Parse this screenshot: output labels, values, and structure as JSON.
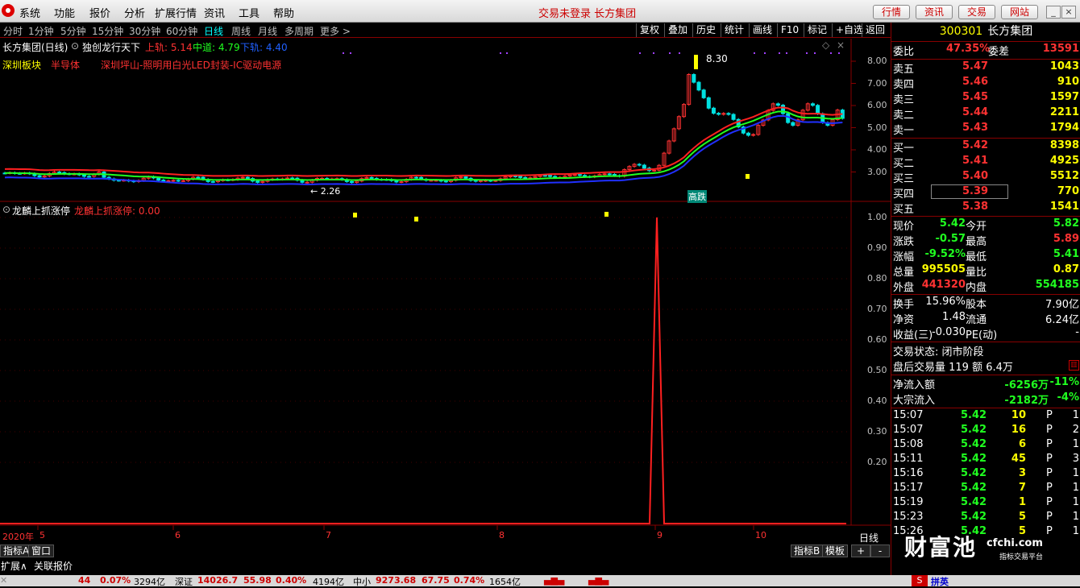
{
  "menu": {
    "items": [
      "系统",
      "功能",
      "报价",
      "分析",
      "扩展行情",
      "资讯",
      "工具",
      "帮助"
    ],
    "title": "交易未登录 长方集团",
    "right_buttons": [
      "行情",
      "资讯",
      "交易",
      "网站"
    ]
  },
  "tabs": {
    "periods": [
      "分时",
      "1分钟",
      "5分钟",
      "15分钟",
      "30分钟",
      "60分钟",
      "日线",
      "周线",
      "月线",
      "多周期",
      "更多 >"
    ],
    "selected": "日线",
    "tools": [
      "复权",
      "叠加",
      "历史",
      "统计",
      "画线",
      "F10",
      "标记",
      "+自选",
      "返回"
    ]
  },
  "chart": {
    "title": "长方集团(日线)",
    "indicator_name": "独创龙行天下",
    "upper": "上轨: 5.14",
    "middle": "中道: 4.79",
    "lower": "下轨: 4.40",
    "tags": [
      "深圳板块",
      "半导体",
      "深圳坪山-照明用白光LED封装-IC驱动电源"
    ],
    "high_mark": "8.30",
    "low_mark": "2.26",
    "event_label": "高跌",
    "price_axis": [
      "8.00",
      "7.00",
      "6.00",
      "5.00",
      "4.00",
      "3.00"
    ],
    "sub_title": "龙麟上抓涨停",
    "sub_value": "龙麟上抓涨停: 0.00",
    "sub_axis": [
      "1.00",
      "0.90",
      "0.80",
      "0.70",
      "0.60",
      "0.50",
      "0.40",
      "0.30",
      "0.20"
    ],
    "date_axis": [
      "2020年",
      "5",
      "6",
      "7",
      "8",
      "9",
      "10"
    ],
    "period_label": "日线"
  },
  "chart_data": {
    "type": "line",
    "title": "龙麟上抓涨停",
    "x": [
      "2020-05",
      "2020-06",
      "2020-07",
      "2020-08",
      "2020-09",
      "2020-10"
    ],
    "ylim": [
      0,
      1
    ],
    "series": [
      {
        "name": "龙麟上抓涨停",
        "values": [
          0,
          0,
          0,
          0,
          1,
          0
        ]
      }
    ]
  },
  "bottom_tabs": {
    "a": "指标A",
    "b": "窗口",
    "c": "扩展∧",
    "d": "关联报价",
    "e": "指标B",
    "f": "模板",
    "g": "+",
    "h": "-"
  },
  "quote": {
    "code": "300301",
    "name": "长方集团",
    "wei_bi": {
      "label": "委比",
      "value": "47.35%",
      "label2": "委差",
      "value2": "13591"
    },
    "sell": [
      [
        "卖五",
        "5.47",
        "1043"
      ],
      [
        "卖四",
        "5.46",
        "910"
      ],
      [
        "卖三",
        "5.45",
        "1597"
      ],
      [
        "卖二",
        "5.44",
        "2211"
      ],
      [
        "卖一",
        "5.43",
        "1794"
      ]
    ],
    "buy": [
      [
        "买一",
        "5.42",
        "8398"
      ],
      [
        "买二",
        "5.41",
        "4925"
      ],
      [
        "买三",
        "5.40",
        "5512"
      ],
      [
        "买四",
        "5.39",
        "770"
      ],
      [
        "买五",
        "5.38",
        "1541"
      ]
    ],
    "stats": [
      [
        "现价",
        "5.42",
        "今开",
        "5.82"
      ],
      [
        "涨跌",
        "-0.57",
        "最高",
        "5.89"
      ],
      [
        "涨幅",
        "-9.52%",
        "最低",
        "5.41"
      ],
      [
        "总量",
        "995505",
        "量比",
        "0.87"
      ],
      [
        "外盘",
        "441320",
        "内盘",
        "554185"
      ]
    ],
    "fund": [
      [
        "换手",
        "15.96%",
        "股本",
        "7.90亿"
      ],
      [
        "净资",
        "1.48",
        "流通",
        "6.24亿"
      ],
      [
        "收益(三)",
        "-0.030",
        "PE(动)",
        "-"
      ]
    ],
    "status": "交易状态: 闭市阶段",
    "after": "盘后交易量 119 额 6.4万",
    "flow": [
      [
        "净流入额",
        "-6256万",
        "-11%"
      ],
      [
        "大宗流入",
        "-2182万",
        "-4%"
      ]
    ],
    "ticks": [
      [
        "15:07",
        "5.42",
        "10",
        "P",
        "1"
      ],
      [
        "15:07",
        "5.42",
        "16",
        "P",
        "2"
      ],
      [
        "15:08",
        "5.42",
        "6",
        "P",
        "1"
      ],
      [
        "15:11",
        "5.42",
        "45",
        "P",
        "3"
      ],
      [
        "15:16",
        "5.42",
        "3",
        "P",
        "1"
      ],
      [
        "15:17",
        "5.42",
        "7",
        "P",
        "1"
      ],
      [
        "15:19",
        "5.42",
        "1",
        "P",
        "1"
      ],
      [
        "15:23",
        "5.42",
        "5",
        "P",
        "1"
      ],
      [
        "15:26",
        "5.42",
        "5",
        "P",
        "1"
      ]
    ]
  },
  "watermark": {
    "main": "财富池",
    "url": "cfchi.com",
    "sub": "指标交易平台"
  },
  "status_bar": {
    "s1": "44",
    "s2": "0.07%",
    "s3": "3294亿",
    "s4": "深证",
    "s5": "14026.7",
    "s6": "55.98",
    "s7": "0.40%",
    "s8": "4194亿",
    "s9": "中小",
    "s10": "9273.68",
    "s11": "67.75",
    "s12": "0.74%",
    "s13": "1654亿",
    "ime": "拼英"
  },
  "colors": {
    "up": "#ff3232",
    "down": "#00e0e0",
    "ma1": "#ff2020",
    "ma2": "#20ff20",
    "ma3": "#2030ff",
    "yellow": "#ffff00"
  }
}
